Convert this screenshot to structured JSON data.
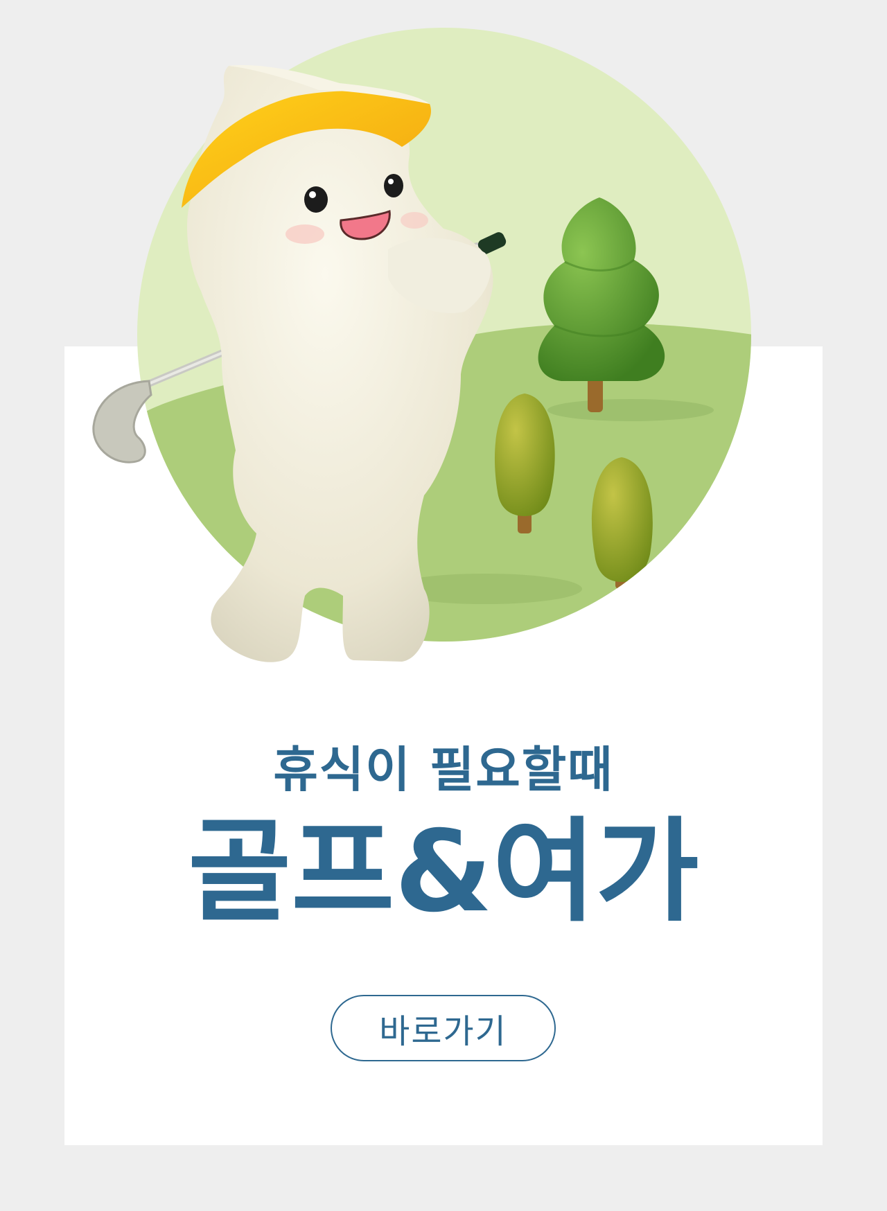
{
  "promo": {
    "subtitle": "휴식이 필요할때",
    "title": "골프&여가",
    "button_label": "바로가기"
  },
  "colors": {
    "background": "#eeeeee",
    "card": "#ffffff",
    "text_accent": "#2e6890",
    "circle_light": "#dfedc0",
    "grass": "#adcd7a",
    "tree_green": "#5d9e34",
    "tree_olive": "#98a62a"
  },
  "illustration": {
    "icon": "mascot-golfer-icon"
  }
}
